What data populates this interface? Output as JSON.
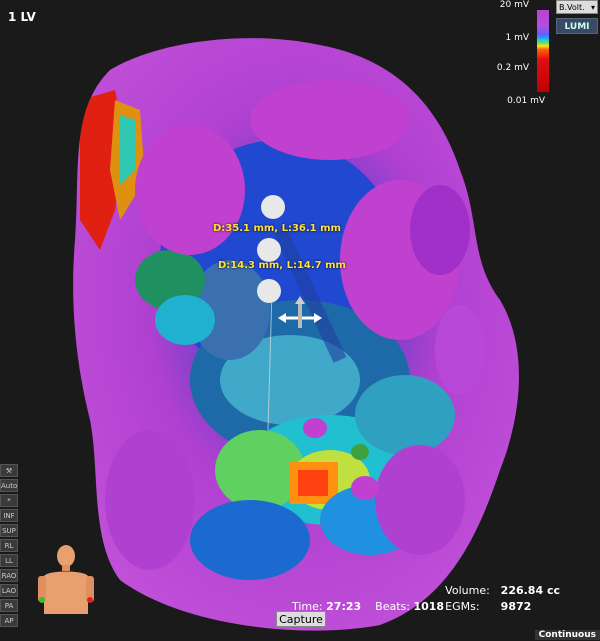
{
  "map": {
    "label": "1 LV"
  },
  "scale": {
    "mode": "B.Volt.",
    "lumi": "LUMI",
    "ticks": [
      "20 mV",
      "1 mV",
      "0.2 mV",
      "0.01 mV"
    ]
  },
  "measurements": [
    "D:35.1 mm, L:36.1 mm",
    "D:14.3 mm, L:14.7 mm"
  ],
  "left_tools": [
    "Auto",
    "*",
    "INF",
    "SUP",
    "RL",
    "LL",
    "RAO",
    "LAO",
    "PA",
    "AP"
  ],
  "stats": {
    "volume_label": "Volume:",
    "volume_value": "226.84 cc",
    "egms_label": "EGMs:",
    "egms_value": "9872"
  },
  "time_label": "Time:",
  "time_value": "27:23",
  "beats_label": "Beats:",
  "beats_value": "1018",
  "capture_label": "Capture",
  "continue_label": "Continuous"
}
